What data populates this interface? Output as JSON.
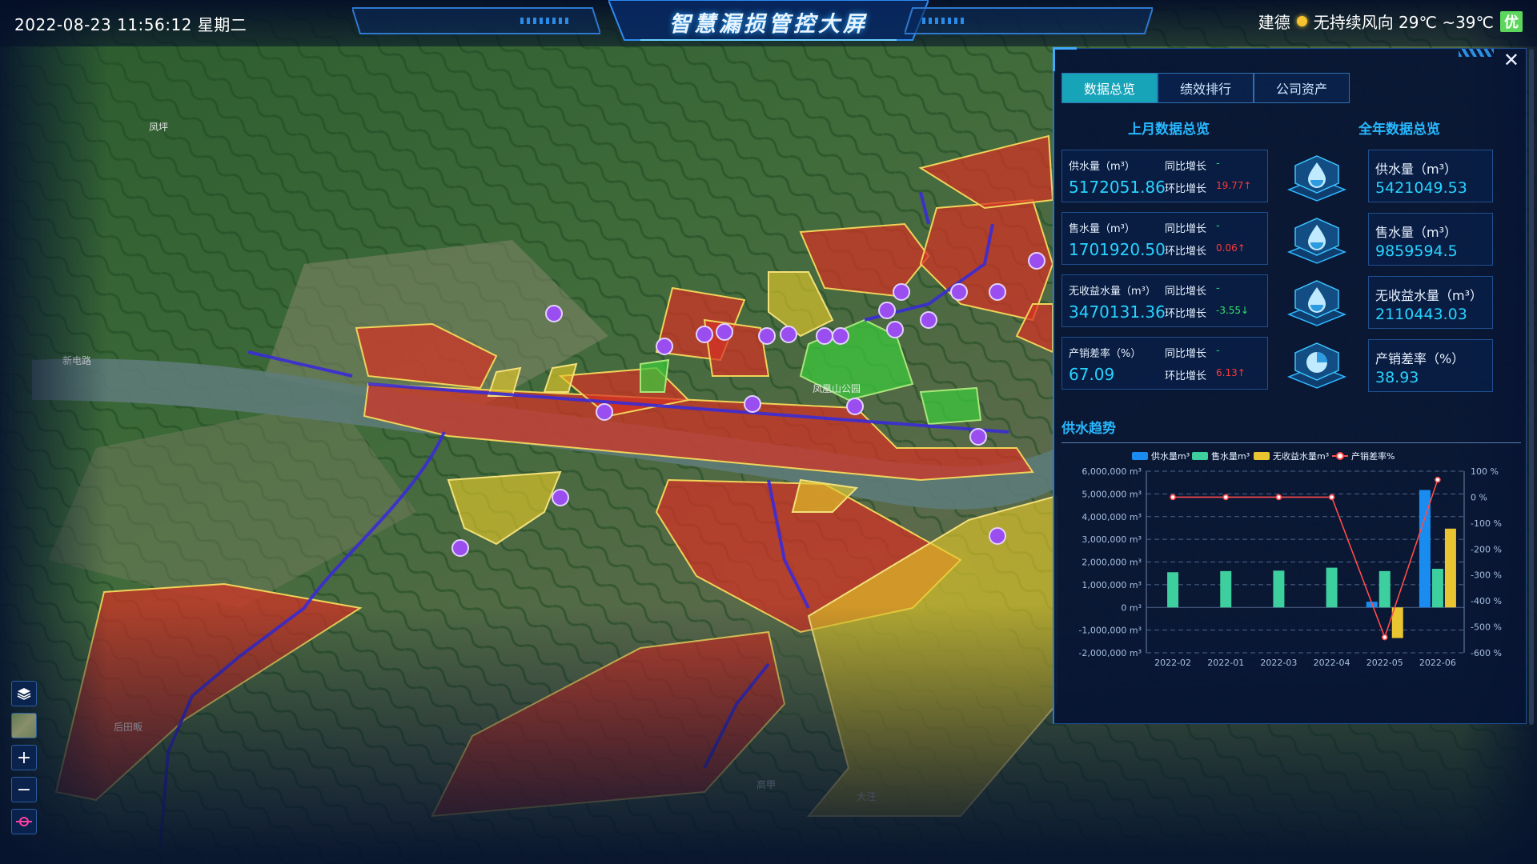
{
  "header": {
    "datetime": "2022-08-23 11:56:12 星期二",
    "title": "智慧漏损管控大屏",
    "city": "建德",
    "weather": "无持续风向 29℃ ~39℃",
    "aqi": "优"
  },
  "map": {
    "labels": [
      "凤坪",
      "新电路",
      "凤凰山公园",
      "后田畈",
      "高甲",
      "大汪"
    ],
    "tools": [
      "layers-icon",
      "satellite-thumb",
      "zoom-in",
      "zoom-out",
      "measure-icon"
    ]
  },
  "panel": {
    "tabs": [
      "数据总览",
      "绩效排行",
      "公司资产"
    ],
    "active_tab": 0,
    "last_month_title": "上月数据总览",
    "year_title": "全年数据总览",
    "last_month": [
      {
        "label": "供水量（m³）",
        "value": "5172051.86",
        "yoy_label": "同比增长",
        "yoy": "-",
        "mom_label": "环比增长",
        "mom": "19.77↑",
        "mom_dir": "up"
      },
      {
        "label": "售水量（m³）",
        "value": "1701920.50",
        "yoy_label": "同比增长",
        "yoy": "-",
        "mom_label": "环比增长",
        "mom": "0.06↑",
        "mom_dir": "up"
      },
      {
        "label": "无收益水量（m³）",
        "value": "3470131.36",
        "yoy_label": "同比增长",
        "yoy": "-",
        "mom_label": "环比增长",
        "mom": "-3.55↓",
        "mom_dir": "down"
      },
      {
        "label": "产销差率（%）",
        "value": "67.09",
        "yoy_label": "同比增长",
        "yoy": "-",
        "mom_label": "环比增长",
        "mom": "6.13↑",
        "mom_dir": "up"
      }
    ],
    "year": [
      {
        "label": "供水量（m³）",
        "value": "5421049.53"
      },
      {
        "label": "售水量（m³）",
        "value": "9859594.5"
      },
      {
        "label": "无收益水量（m³）",
        "value": "2110443.03"
      },
      {
        "label": "产销差率（%）",
        "value": "38.93"
      }
    ],
    "trend_title": "供水趋势"
  },
  "colors": {
    "supply": "#1a8cf0",
    "sales": "#3ecf9e",
    "nonrevenue": "#e8c531",
    "rate": "#ff4b4b"
  },
  "chart_data": {
    "type": "bar",
    "categories": [
      "2022-02",
      "2022-01",
      "2022-03",
      "2022-04",
      "2022-05",
      "2022-06"
    ],
    "series": [
      {
        "name": "供水量m³",
        "type": "bar",
        "axis": "left",
        "values": [
          0,
          0,
          0,
          0,
          250000,
          5172051.86
        ]
      },
      {
        "name": "售水量m³",
        "type": "bar",
        "axis": "left",
        "values": [
          1550000,
          1600000,
          1620000,
          1750000,
          1600000,
          1701920.5
        ]
      },
      {
        "name": "无收益水量m³",
        "type": "bar",
        "axis": "left",
        "values": [
          0,
          0,
          0,
          0,
          -1350000,
          3470131.36
        ]
      },
      {
        "name": "产销差率%",
        "type": "line",
        "axis": "right",
        "values": [
          0,
          0,
          0,
          0,
          -540,
          67.09
        ]
      }
    ],
    "left_axis": {
      "min": -2000000,
      "max": 6000000,
      "step": 1000000,
      "ticks": [
        "-2,000,000 m³",
        "-1,000,000 m³",
        "0 m³",
        "1,000,000 m³",
        "2,000,000 m³",
        "3,000,000 m³",
        "4,000,000 m³",
        "5,000,000 m³",
        "6,000,000 m³"
      ]
    },
    "right_axis": {
      "min": -600,
      "max": 100,
      "step": 100,
      "ticks": [
        "-600 %",
        "-500 %",
        "-400 %",
        "-300 %",
        "-200 %",
        "-100 %",
        "0 %",
        "100 %"
      ]
    },
    "grid": true,
    "legend_position": "top"
  }
}
